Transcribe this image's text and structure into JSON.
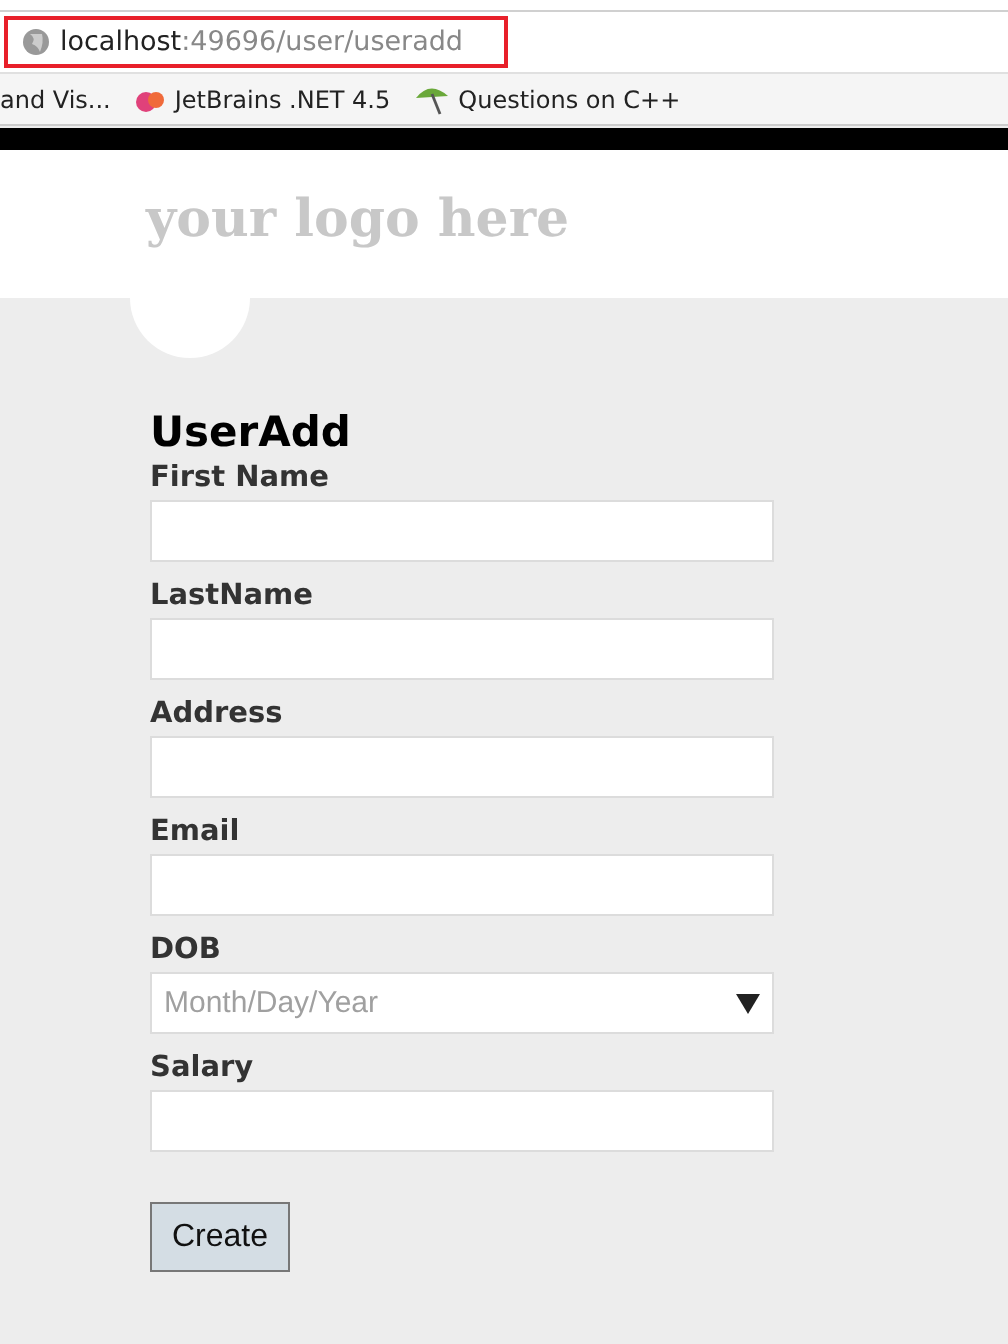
{
  "address_bar": {
    "host": "localhost",
    "path": ":49696/user/useradd"
  },
  "bookmarks": [
    {
      "label": "and Vis...",
      "kind": "plain"
    },
    {
      "label": "JetBrains .NET 4.5",
      "kind": "jetbrains"
    },
    {
      "label": "Questions on C++",
      "kind": "umbrella"
    }
  ],
  "logo": "your logo here",
  "form": {
    "title": "UserAdd",
    "fields": [
      {
        "label": "First Name",
        "kind": "text"
      },
      {
        "label": "LastName",
        "kind": "text"
      },
      {
        "label": "Address",
        "kind": "text"
      },
      {
        "label": "Email",
        "kind": "text"
      },
      {
        "label": "DOB",
        "kind": "date",
        "placeholder": "Month/Day/Year"
      },
      {
        "label": "Salary",
        "kind": "text"
      }
    ],
    "submit": "Create"
  }
}
